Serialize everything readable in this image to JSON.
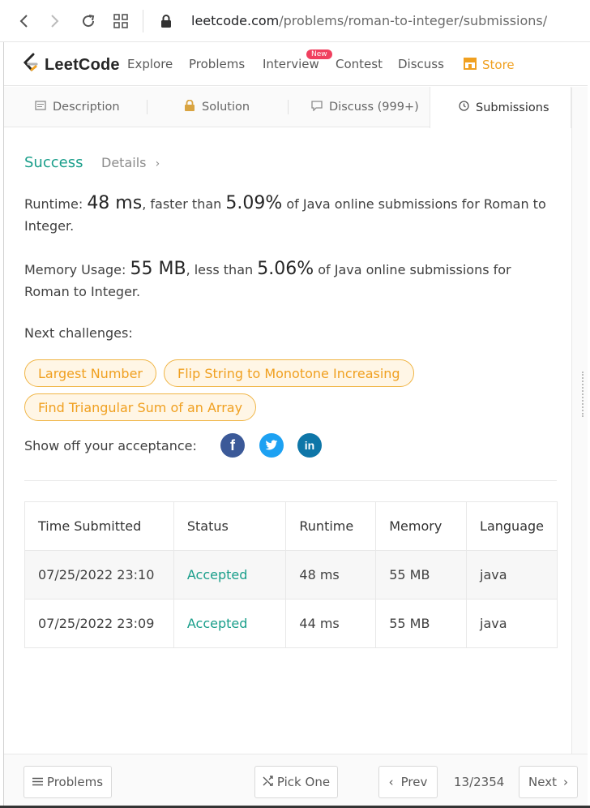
{
  "browser": {
    "url_host": "leetcode.com",
    "url_path": "/problems/roman-to-integer/submissions/"
  },
  "nav": {
    "logo_text": "LeetCode",
    "links": [
      "Explore",
      "Problems",
      "Interview",
      "Contest",
      "Discuss"
    ],
    "badge": "New",
    "store": "Store"
  },
  "tabs": [
    {
      "label": "Description",
      "icon": "description-icon"
    },
    {
      "label": "Solution",
      "icon": "lock-icon"
    },
    {
      "label": "Discuss (999+)",
      "icon": "comment-icon"
    },
    {
      "label": "Submissions",
      "icon": "clock-icon"
    }
  ],
  "result": {
    "status": "Success",
    "details": "Details",
    "runtime_prefix": "Runtime:",
    "runtime_value": "48 ms",
    "runtime_mid": ", faster than",
    "runtime_pct": "5.09%",
    "runtime_suffix": "of Java online submissions for Roman to Integer.",
    "memory_prefix": "Memory Usage:",
    "memory_value": "55 MB",
    "memory_mid": ", less than",
    "memory_pct": "5.06%",
    "memory_suffix": "of Java online submissions for Roman to Integer."
  },
  "challenges": {
    "label": "Next challenges:",
    "items": [
      "Largest Number",
      "Flip String to Monotone Increasing",
      "Find Triangular Sum of an Array"
    ]
  },
  "share": {
    "label": "Show off your acceptance:"
  },
  "table": {
    "headers": [
      "Time Submitted",
      "Status",
      "Runtime",
      "Memory",
      "Language"
    ],
    "rows": [
      [
        "07/25/2022 23:10",
        "Accepted",
        "48 ms",
        "55 MB",
        "java"
      ],
      [
        "07/25/2022 23:09",
        "Accepted",
        "44 ms",
        "55 MB",
        "java"
      ]
    ]
  },
  "footer": {
    "problems": "Problems",
    "pick_one": "Pick One",
    "prev": "Prev",
    "page": "13/2354",
    "next": "Next"
  },
  "colors": {
    "accent_green": "#199e8a",
    "store_orange": "#f0a020",
    "facebook": "#3b5998",
    "twitter": "#1da1f2",
    "linkedin": "#0e76a8"
  }
}
